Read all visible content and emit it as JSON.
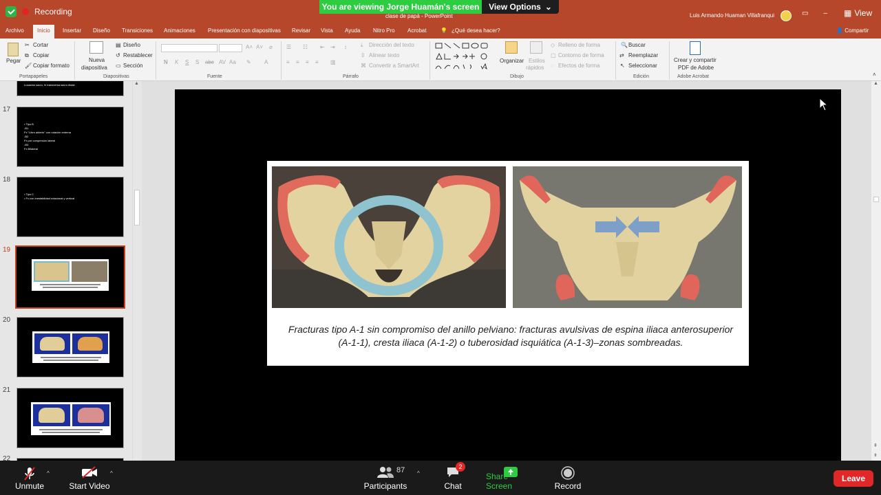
{
  "zoom": {
    "recording_label": "Recording",
    "viewing_banner": "You are viewing Jorge Huamán's screen",
    "view_options": "View Options",
    "view_button": "View",
    "bottom": {
      "unmute": "Unmute",
      "start_video": "Start Video",
      "participants": "Participants",
      "participants_count": "87",
      "chat": "Chat",
      "chat_badge": "2",
      "share_screen": "Share Screen",
      "record": "Record",
      "leave": "Leave"
    },
    "colors": {
      "banner": "#2ecc40",
      "share": "#2ecc40",
      "leave": "#e02828"
    }
  },
  "powerpoint": {
    "doc_title": "clase de papá - PowerPoint",
    "user": "Luis Armando Huaman Villafranqui",
    "share": "Compartir",
    "tabs": [
      "Archivo",
      "Inicio",
      "Insertar",
      "Diseño",
      "Transiciones",
      "Animaciones",
      "Presentación con diapositivas",
      "Revisar",
      "Vista",
      "Ayuda",
      "Nitro Pro",
      "Acrobat",
      "¿Qué desea hacer?"
    ],
    "active_tab": "Inicio",
    "ribbon": {
      "paste": "Pegar",
      "cut": "Cortar",
      "copy": "Copiar",
      "copy_format": "Copiar formato",
      "new_slide_1": "Nueva",
      "new_slide_2": "diapositiva",
      "design": "Diseño",
      "reset": "Restablecer",
      "section": "Sección",
      "text_direction": "Dirección del texto",
      "align_text": "Alinear texto",
      "convert_smartart": "Convertir a SmartArt",
      "organize": "Organizar",
      "quick_styles_1": "Estilos",
      "quick_styles_2": "rápidos",
      "shape_fill": "Relleno de forma",
      "shape_outline": "Contorno de forma",
      "shape_effects": "Efectos de forma",
      "find": "Buscar",
      "replace": "Reemplazar",
      "select": "Seleccionar",
      "create_pdf_1": "Crear y compartir",
      "create_pdf_2": "PDF de Adobe",
      "groups": {
        "clipboard": "Portapapeles",
        "slides": "Diapositivas",
        "font": "Fuente",
        "paragraph": "Párrafo",
        "drawing": "Dibujo",
        "editing": "Edición",
        "adobe": "Adobe Acrobat"
      }
    },
    "thumbnails": {
      "top_fragment": "Luxación sacro, fx transversa sacro distal.",
      "slide17_number": "17",
      "slide17_lines": [
        "• Tipo B",
        "-B1",
        "Fx \"Libro abierto\" con rotación externa",
        "-B2",
        "Fx por compresión lateral",
        "-B3",
        "Fx Bilateral"
      ],
      "slide18_number": "18",
      "slide18_lines": [
        "• Tipo C",
        "• Fx con inestabilidad rotacional y vertical."
      ],
      "slide19_number": "19",
      "slide20_number": "20",
      "slide21_number": "21",
      "slide22_number": "22"
    },
    "slide": {
      "caption": "Fracturas tipo A-1 sin compromiso del anillo pelviano: fracturas avulsivas de espina iliaca anterosuperior (A-1-1), cresta iliaca (A-1-2) o tuberosidad isquiática (A-1-3)–zonas sombreadas."
    }
  }
}
